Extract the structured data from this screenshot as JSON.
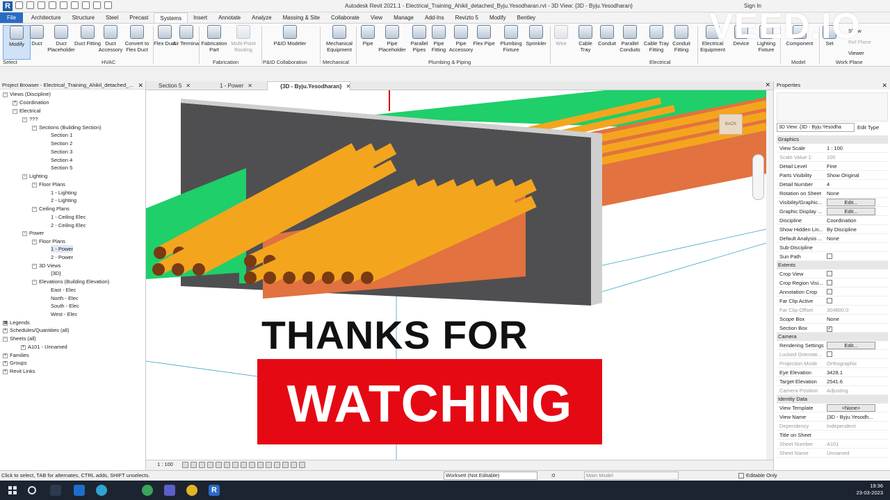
{
  "titlebar": {
    "title": "Autodesk Revit 2021.1 - Electrical_Training_Ahikil_detached_Byju.Yesodharan.rvt - 3D View: {3D - Byju.Yesodharan}",
    "signin": "Sign In"
  },
  "tabs": [
    "File",
    "Architecture",
    "Structure",
    "Steel",
    "Precast",
    "Systems",
    "Insert",
    "Annotate",
    "Analyze",
    "Massing & Site",
    "Collaborate",
    "View",
    "Manage",
    "Add-Ins",
    "Revizto 5",
    "Modify",
    "Bentley"
  ],
  "ribbon": {
    "tools": [
      {
        "label": "Modify"
      },
      {
        "label": "Duct"
      },
      {
        "label": "Duct Placeholder"
      },
      {
        "label": "Duct Fitting"
      },
      {
        "label": "Duct Accessory"
      },
      {
        "label": "Convert to Flex Duct"
      },
      {
        "label": "Flex Duct"
      },
      {
        "label": "Air Terminal"
      },
      {
        "label": "Fabrication Part"
      },
      {
        "label": "Multi-Point Routing"
      },
      {
        "label": "P&ID Modeler"
      },
      {
        "label": "Mechanical Equipment"
      },
      {
        "label": "Pipe"
      },
      {
        "label": "Pipe Placeholder"
      },
      {
        "label": "Parallel Pipes"
      },
      {
        "label": "Pipe Fitting"
      },
      {
        "label": "Pipe Accessory"
      },
      {
        "label": "Flex Pipe"
      },
      {
        "label": "Plumbing Fixture"
      },
      {
        "label": "Sprinkler"
      },
      {
        "label": "Wire"
      },
      {
        "label": "Cable Tray"
      },
      {
        "label": "Conduit"
      },
      {
        "label": "Parallel Conduits"
      },
      {
        "label": "Cable Tray Fitting"
      },
      {
        "label": "Conduit Fitting"
      },
      {
        "label": "Electrical Equipment"
      },
      {
        "label": "Device"
      },
      {
        "label": "Lighting Fixture"
      },
      {
        "label": "Component"
      },
      {
        "label": "Set"
      },
      {
        "label": "Show"
      }
    ],
    "groups": [
      "Select",
      "HVAC",
      "Fabrication",
      "P&ID Collaboration",
      "Mechanical",
      "Plumbing & Piping",
      "Electrical",
      "Model",
      "Work Plane"
    ],
    "extra": [
      "Ref Plane",
      "Viewer"
    ]
  },
  "browser": {
    "title": "Project Browser - Electrical_Training_Ahikil_detached_...",
    "items": [
      "Views (Discipline)",
      "Coordination",
      "Electrical",
      "???",
      "Sections (Building Section)",
      "Section 1",
      "Section 2",
      "Section 3",
      "Section 4",
      "Section 5",
      "Lighting",
      "Floor Plans",
      "1 - Lighting",
      "2 - Lighting",
      "Ceiling Plans",
      "1 - Ceiling Elec",
      "2 - Ceiling Elec",
      "Power",
      "Floor Plans",
      "1 - Power",
      "2 - Power",
      "3D Views",
      "{3D}",
      "Elevations (Building Elevation)",
      "East - Elec",
      "North - Elec",
      "South - Elec",
      "West - Elec",
      "Legends",
      "Schedules/Quantities (all)",
      "Sheets (all)",
      "A101 - Unnamed",
      "Families",
      "Groups",
      "Revit Links"
    ]
  },
  "viewtabs": [
    {
      "label": "Section 5"
    },
    {
      "label": "1 - Power"
    },
    {
      "label": "{3D - Byju.Yesodharan}"
    }
  ],
  "overlay": {
    "line1": "THANKS FOR",
    "line2": "WATCHING"
  },
  "watermark": "VEED.IO",
  "viewctl": {
    "scale": "1 : 100"
  },
  "properties": {
    "title": "Properties",
    "type_selector": "3D View: {3D - Byju.Yesodha",
    "edit_type": "Edit Type",
    "sections": [
      {
        "name": "Graphics",
        "rows": [
          [
            "View Scale",
            "1 : 100"
          ],
          [
            "Scale Value    1:",
            "100"
          ],
          [
            "Detail Level",
            "Fine"
          ],
          [
            "Parts Visibility",
            "Show Original"
          ],
          [
            "Detail Number",
            "4"
          ],
          [
            "Rotation on Sheet",
            "None"
          ],
          [
            "Visibility/Graphic...",
            "Edit..."
          ],
          [
            "Graphic Display ...",
            "Edit..."
          ],
          [
            "Discipline",
            "Coordination"
          ],
          [
            "Show Hidden Lin...",
            "By Discipline"
          ],
          [
            "Default Analysis ...",
            "None"
          ],
          [
            "Sub-Discipline",
            ""
          ],
          [
            "Sun Path",
            ""
          ]
        ]
      },
      {
        "name": "Extents",
        "rows": [
          [
            "Crop View",
            ""
          ],
          [
            "Crop Region Visi...",
            ""
          ],
          [
            "Annotation Crop",
            ""
          ],
          [
            "Far Clip Active",
            ""
          ],
          [
            "Far Clip Offset",
            "304800.0"
          ],
          [
            "Scope Box",
            "None"
          ],
          [
            "Section Box",
            ""
          ]
        ]
      },
      {
        "name": "Camera",
        "rows": [
          [
            "Rendering Settings",
            "Edit..."
          ],
          [
            "Locked Orientati...",
            ""
          ],
          [
            "Projection Mode",
            "Orthographic"
          ],
          [
            "Eye Elevation",
            "3428.1"
          ],
          [
            "Target Elevation",
            "2541.6"
          ],
          [
            "Camera Position",
            "Adjusting"
          ]
        ]
      },
      {
        "name": "Identity Data",
        "rows": [
          [
            "View Template",
            "<None>"
          ],
          [
            "View Name",
            "{3D - Byju.Yesodh..."
          ],
          [
            "Dependency",
            "Independent"
          ],
          [
            "Title on Sheet",
            ""
          ],
          [
            "Sheet Number",
            "A101"
          ],
          [
            "Sheet Name",
            "Unnamed"
          ]
        ]
      }
    ]
  },
  "statusbar": {
    "message": "Click to select, TAB for alternates, CTRL adds, SHIFT unselects.",
    "workset": "Worksett (Not Editable)",
    "zero": ":0",
    "model": "Main Model",
    "editable": "Editable Only"
  },
  "taskbar": {
    "time": "19:36",
    "date": "23-03-2023"
  }
}
